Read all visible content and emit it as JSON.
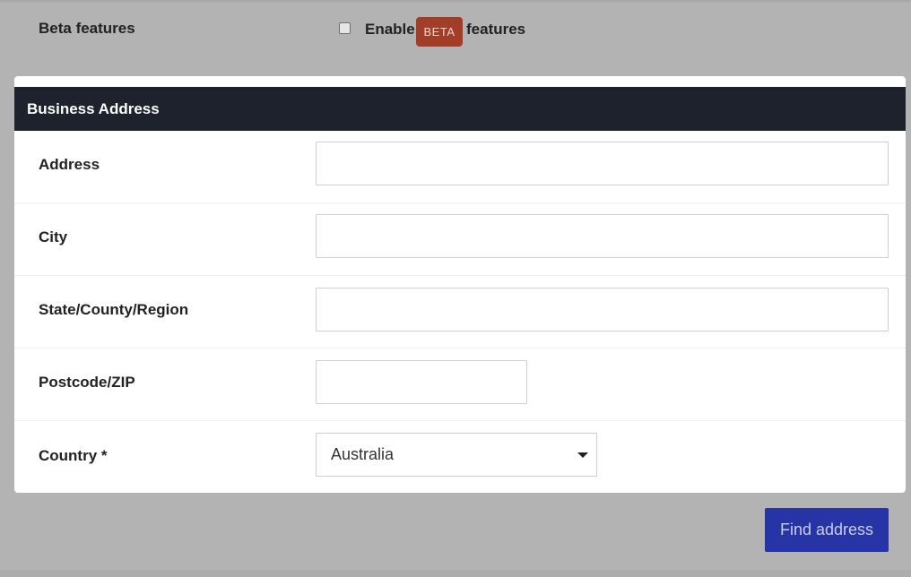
{
  "beta": {
    "section_label": "Beta features",
    "checkbox_checked": false,
    "enable_text": "Enable",
    "badge_text": "BETA",
    "features_text": "features",
    "badge_color": "#a23d28"
  },
  "business_address": {
    "title": "Business Address",
    "header_color": "#1d222c",
    "fields": {
      "address": {
        "label": "Address",
        "value": ""
      },
      "city": {
        "label": "City",
        "value": ""
      },
      "state": {
        "label": "State/County/Region",
        "value": ""
      },
      "postcode": {
        "label": "Postcode/ZIP",
        "value": ""
      },
      "country": {
        "label": "Country *",
        "value": "Australia"
      }
    }
  },
  "actions": {
    "find_address_label": "Find address",
    "button_color": "#2634a6"
  }
}
